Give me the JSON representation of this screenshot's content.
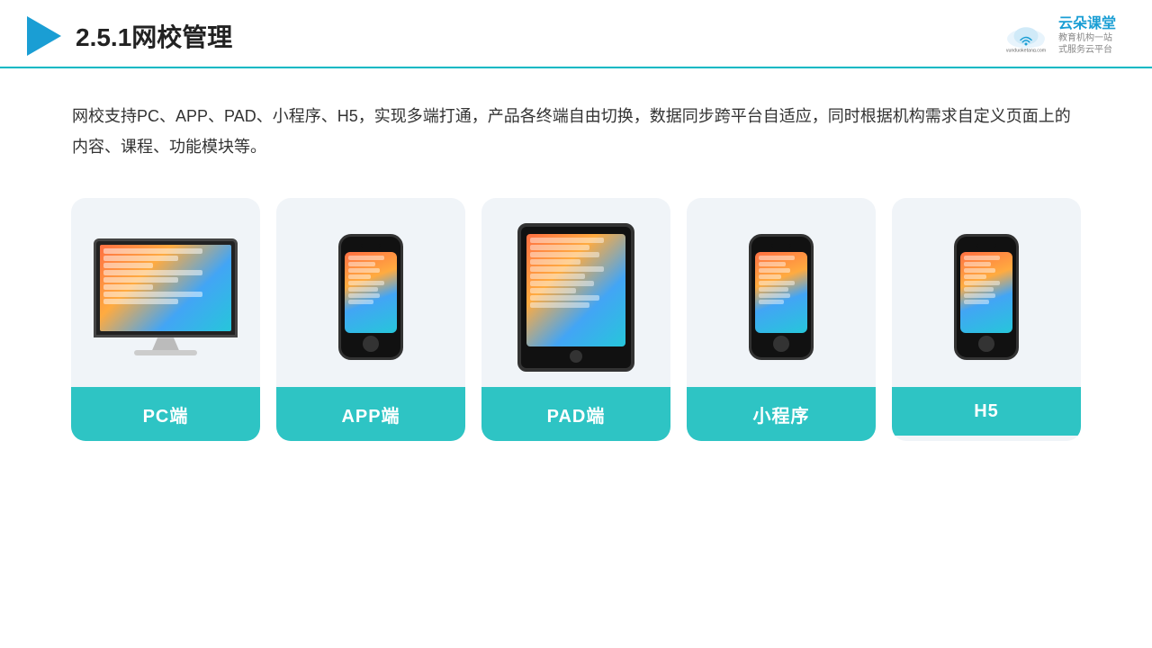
{
  "header": {
    "title": "2.5.1网校管理",
    "logo_name": "云朵课堂",
    "logo_url": "yunduoketang.com",
    "logo_tagline": "教育机构一站\n式服务云平台"
  },
  "description": {
    "text": "网校支持PC、APP、PAD、小程序、H5，实现多端打通，产品各终端自由切换，数据同步跨平台自适应，同时根据机构需求自定义页面上的内容、课程、功能模块等。"
  },
  "cards": [
    {
      "id": "pc",
      "label": "PC端",
      "type": "pc"
    },
    {
      "id": "app",
      "label": "APP端",
      "type": "phone"
    },
    {
      "id": "pad",
      "label": "PAD端",
      "type": "tablet"
    },
    {
      "id": "mini",
      "label": "小程序",
      "type": "phone"
    },
    {
      "id": "h5",
      "label": "H5",
      "type": "phone"
    }
  ]
}
